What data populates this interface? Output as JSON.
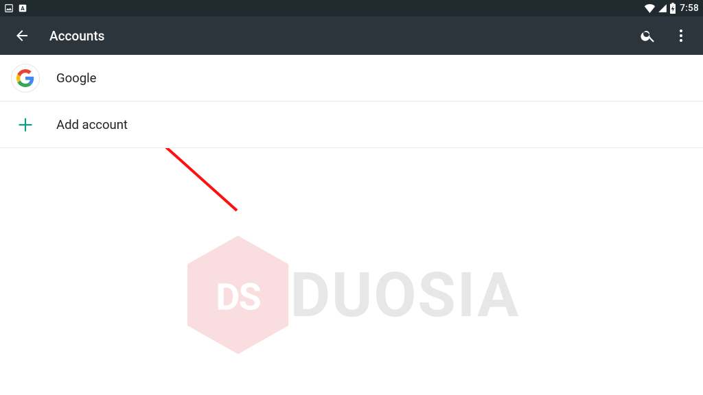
{
  "status": {
    "time": "7:58"
  },
  "toolbar": {
    "title": "Accounts"
  },
  "list": {
    "items": [
      {
        "label": "Google"
      },
      {
        "label": "Add account"
      }
    ]
  },
  "watermark": {
    "badge": "DS",
    "text": "DUOSIA"
  },
  "colors": {
    "teal": "#0f9d86",
    "arrow": "#ff0f0e",
    "wm_hex": "#f7bfc0"
  }
}
